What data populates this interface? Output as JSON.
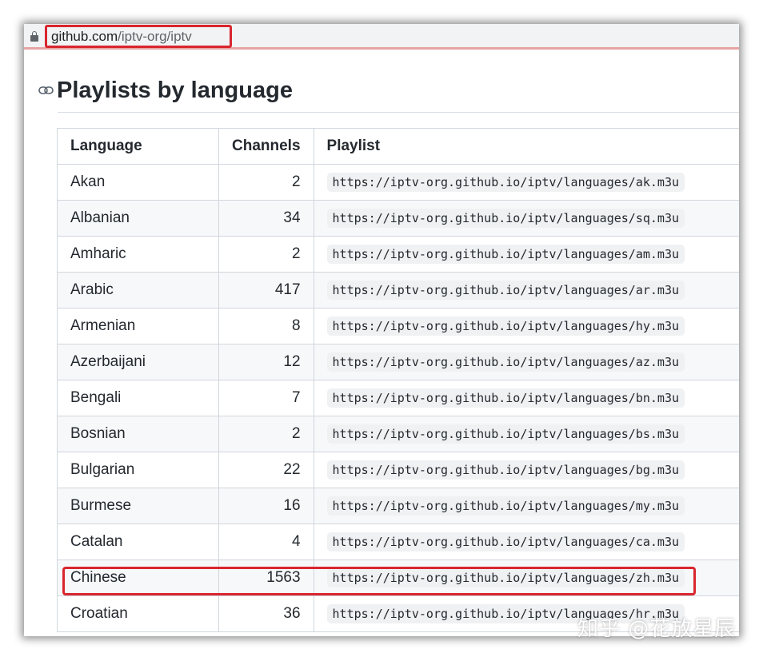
{
  "address_bar": {
    "url_host": "github.com",
    "url_path": "/iptv-org/iptv"
  },
  "heading": "Playlists by language",
  "table": {
    "headers": [
      "Language",
      "Channels",
      "Playlist"
    ],
    "rows": [
      {
        "language": "Akan",
        "channels": "2",
        "playlist": "https://iptv-org.github.io/iptv/languages/ak.m3u"
      },
      {
        "language": "Albanian",
        "channels": "34",
        "playlist": "https://iptv-org.github.io/iptv/languages/sq.m3u"
      },
      {
        "language": "Amharic",
        "channels": "2",
        "playlist": "https://iptv-org.github.io/iptv/languages/am.m3u"
      },
      {
        "language": "Arabic",
        "channels": "417",
        "playlist": "https://iptv-org.github.io/iptv/languages/ar.m3u"
      },
      {
        "language": "Armenian",
        "channels": "8",
        "playlist": "https://iptv-org.github.io/iptv/languages/hy.m3u"
      },
      {
        "language": "Azerbaijani",
        "channels": "12",
        "playlist": "https://iptv-org.github.io/iptv/languages/az.m3u"
      },
      {
        "language": "Bengali",
        "channels": "7",
        "playlist": "https://iptv-org.github.io/iptv/languages/bn.m3u"
      },
      {
        "language": "Bosnian",
        "channels": "2",
        "playlist": "https://iptv-org.github.io/iptv/languages/bs.m3u"
      },
      {
        "language": "Bulgarian",
        "channels": "22",
        "playlist": "https://iptv-org.github.io/iptv/languages/bg.m3u"
      },
      {
        "language": "Burmese",
        "channels": "16",
        "playlist": "https://iptv-org.github.io/iptv/languages/my.m3u"
      },
      {
        "language": "Catalan",
        "channels": "4",
        "playlist": "https://iptv-org.github.io/iptv/languages/ca.m3u"
      },
      {
        "language": "Chinese",
        "channels": "1563",
        "playlist": "https://iptv-org.github.io/iptv/languages/zh.m3u"
      },
      {
        "language": "Croatian",
        "channels": "36",
        "playlist": "https://iptv-org.github.io/iptv/languages/hr.m3u"
      }
    ]
  },
  "watermark": "知乎 @花放星辰",
  "colors": {
    "highlight": "#d9262e",
    "text": "#24292f",
    "border": "#d0d7de"
  },
  "icons": [
    "lock-icon",
    "link-icon"
  ]
}
